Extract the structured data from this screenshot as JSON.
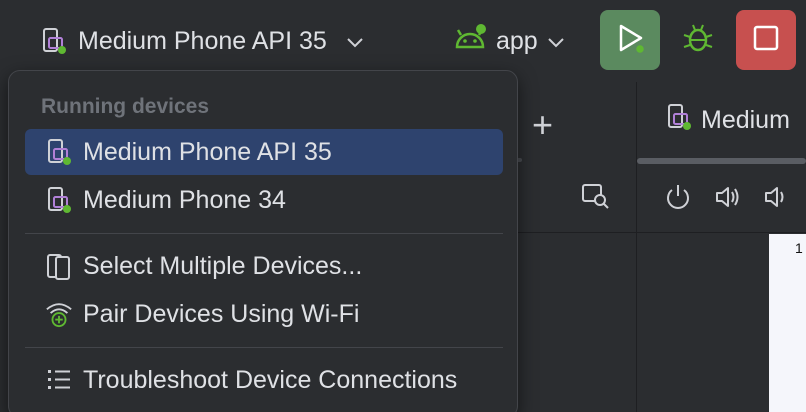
{
  "toolbar": {
    "device_label": "Medium Phone API 35",
    "app_label": "app"
  },
  "popup": {
    "section_header": "Running devices",
    "items": [
      {
        "label": "Medium Phone API 35",
        "icon": "device-running-icon",
        "selected": true
      },
      {
        "label": "Medium Phone 34",
        "icon": "device-running-icon",
        "selected": false
      },
      {
        "label": "Select Multiple Devices...",
        "icon": "multiple-devices-icon",
        "selected": false
      },
      {
        "label": "Pair Devices Using Wi-Fi",
        "icon": "wifi-pair-icon",
        "selected": false
      },
      {
        "label": "Troubleshoot Device Connections",
        "icon": "troubleshoot-list-icon",
        "selected": false
      }
    ]
  },
  "right_pane": {
    "tab_label": "Medium",
    "screen_text": "1"
  },
  "colors": {
    "accent_selected": "#2e436e",
    "run_button": "#5b8a5f",
    "stop_button": "#c7504f",
    "running_dot": "#5fb832",
    "device_icon_purple": "#b180d7"
  }
}
